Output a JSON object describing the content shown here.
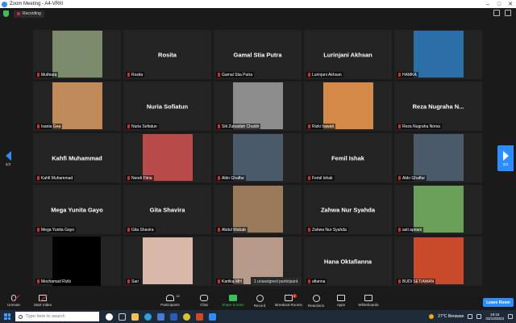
{
  "window": {
    "title": "Zoom Meeting - A4-VRIII"
  },
  "recording": {
    "label": "Recording"
  },
  "tiles": [
    {
      "display_name": "",
      "label": "Muthiara",
      "photo": true,
      "photo_color": "#7a8a6a"
    },
    {
      "display_name": "Rosita",
      "label": "Rosita",
      "photo": false
    },
    {
      "display_name": "Gamal Stia Putra",
      "label": "Gamal Stia Putra",
      "photo": false
    },
    {
      "display_name": "Lurinjani Akhsan",
      "label": "Lurinjani Akhsan",
      "photo": false
    },
    {
      "display_name": "",
      "label": "HAMKA",
      "photo": true,
      "photo_color": "#2b6ea8"
    },
    {
      "display_name": "",
      "label": "Isania Gea",
      "photo": true,
      "photo_color": "#c08b5a"
    },
    {
      "display_name": "Nuria Sofiatun",
      "label": "Nuria Sofiatun",
      "photo": false
    },
    {
      "display_name": "",
      "label": "Siti Zubaidah Chaidir",
      "photo": true,
      "photo_color": "#8c8c8c"
    },
    {
      "display_name": "",
      "label": "Rizki Irawati",
      "photo": true,
      "photo_color": "#d68a4a"
    },
    {
      "display_name": "Reza Nugraha N...",
      "label": "Reza Nugraha Norsa",
      "photo": false
    },
    {
      "display_name": "Kahfi Muhammad",
      "label": "Kahfi Muhammad",
      "photo": false
    },
    {
      "display_name": "",
      "label": "Nendi Fitria",
      "photo": true,
      "photo_color": "#b84a4a"
    },
    {
      "display_name": "",
      "label": "Aldo Ghaffar",
      "photo": true,
      "photo_color": "#4a5a6a"
    },
    {
      "display_name": "Femil Ishak",
      "label": "Femil Ishak",
      "photo": false
    },
    {
      "display_name": "",
      "label": "Aldo Ghaffar",
      "photo": true,
      "photo_color": "#4a5a6a"
    },
    {
      "display_name": "Mega Yunita Gayo",
      "label": "Mega Yunita Gayo",
      "photo": false
    },
    {
      "display_name": "Gita Shavira",
      "label": "Gita Shavira",
      "photo": false
    },
    {
      "display_name": "",
      "label": "Abdul Wahab",
      "photo": true,
      "photo_color": "#9a7a5a"
    },
    {
      "display_name": "Zahwa Nur Syahda",
      "label": "Zahwa Nur Syahda",
      "photo": false
    },
    {
      "display_name": "",
      "label": "asti apriani",
      "photo": true,
      "photo_color": "#6aa05a"
    },
    {
      "display_name": "",
      "label": "Mochamad Rizki",
      "photo": true,
      "photo_color": "#000000"
    },
    {
      "display_name": "",
      "label": "Sari",
      "photo": true,
      "photo_color": "#d8b8a8"
    },
    {
      "display_name": "",
      "label": "Kartika MH",
      "photo": true,
      "photo_color": "#b89a8a"
    },
    {
      "display_name": "Hana Oktafianna",
      "label": "afianna",
      "photo": false
    },
    {
      "display_name": "",
      "label": "BUDI SETIAWAN",
      "photo": true,
      "photo_color": "#c84a2a"
    }
  ],
  "pagination": {
    "left": "2/3",
    "right": "2/3"
  },
  "unassigned": "1 unassigned participant",
  "toolbar": {
    "unmute": "Unmute",
    "start_video": "Start Video",
    "participants": "Participants",
    "participants_count": "52",
    "chat": "Chat",
    "share": "Share Screen",
    "record": "Record",
    "breakout": "Breakout Rooms",
    "breakout_badge": "1",
    "reactions": "Reactions",
    "apps": "Apps",
    "whiteboards": "Whiteboards",
    "leave": "Leave Room"
  },
  "taskbar": {
    "search_placeholder": "Type here to search",
    "weather": "27°C Berawan",
    "time": "19:15",
    "date": "03/13/2023"
  },
  "colors": {
    "accent": "#2d8cff",
    "muted_mic": "#e02828",
    "share_green": "#3bbf5a"
  }
}
